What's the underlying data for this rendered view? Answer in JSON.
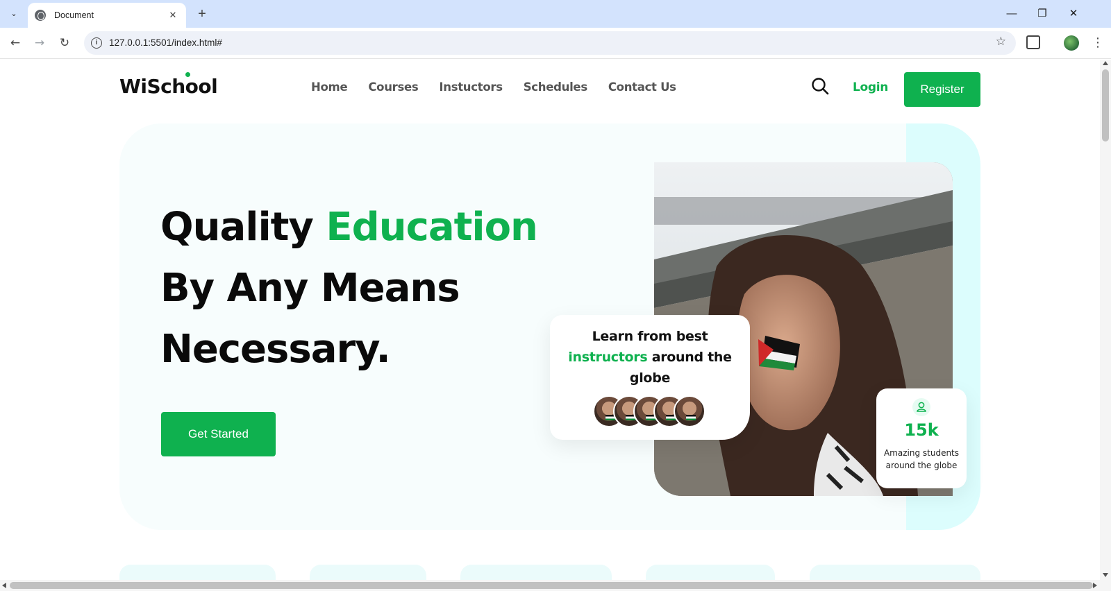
{
  "browser": {
    "tab_title": "Document",
    "tab_close": "✕",
    "new_tab": "+",
    "url": "127.0.0.1:5501/index.html#",
    "window_controls": {
      "minimize": "—",
      "restore": "❐",
      "close": "✕"
    },
    "nav": {
      "back": "←",
      "forward": "→",
      "reload": "↻"
    },
    "bookmark_star": "☆",
    "menu": "⋮",
    "tab_search": "⌄"
  },
  "site": {
    "logo": "WiSchool",
    "nav_items": [
      "Home",
      "Courses",
      "Instuctors",
      "Schedules",
      "Contact Us"
    ],
    "login_label": "Login",
    "register_label": "Register"
  },
  "hero": {
    "headline_part1": "Quality ",
    "headline_accent": "Education",
    "headline_line2": "By Any Means",
    "headline_line3": "Necessary.",
    "cta_label": "Get Started",
    "learn_card": {
      "line1": "Learn from best",
      "accent": "instructors",
      "rest": " around the globe"
    },
    "stats": {
      "number": "15k",
      "label": "Amazing students around the globe"
    }
  },
  "colors": {
    "brand_green": "#0fb14f",
    "hero_bg": "#f7fdfd",
    "hero_strip": "#dcfdfd",
    "chrome_tabstrip": "#d3e3fd"
  }
}
